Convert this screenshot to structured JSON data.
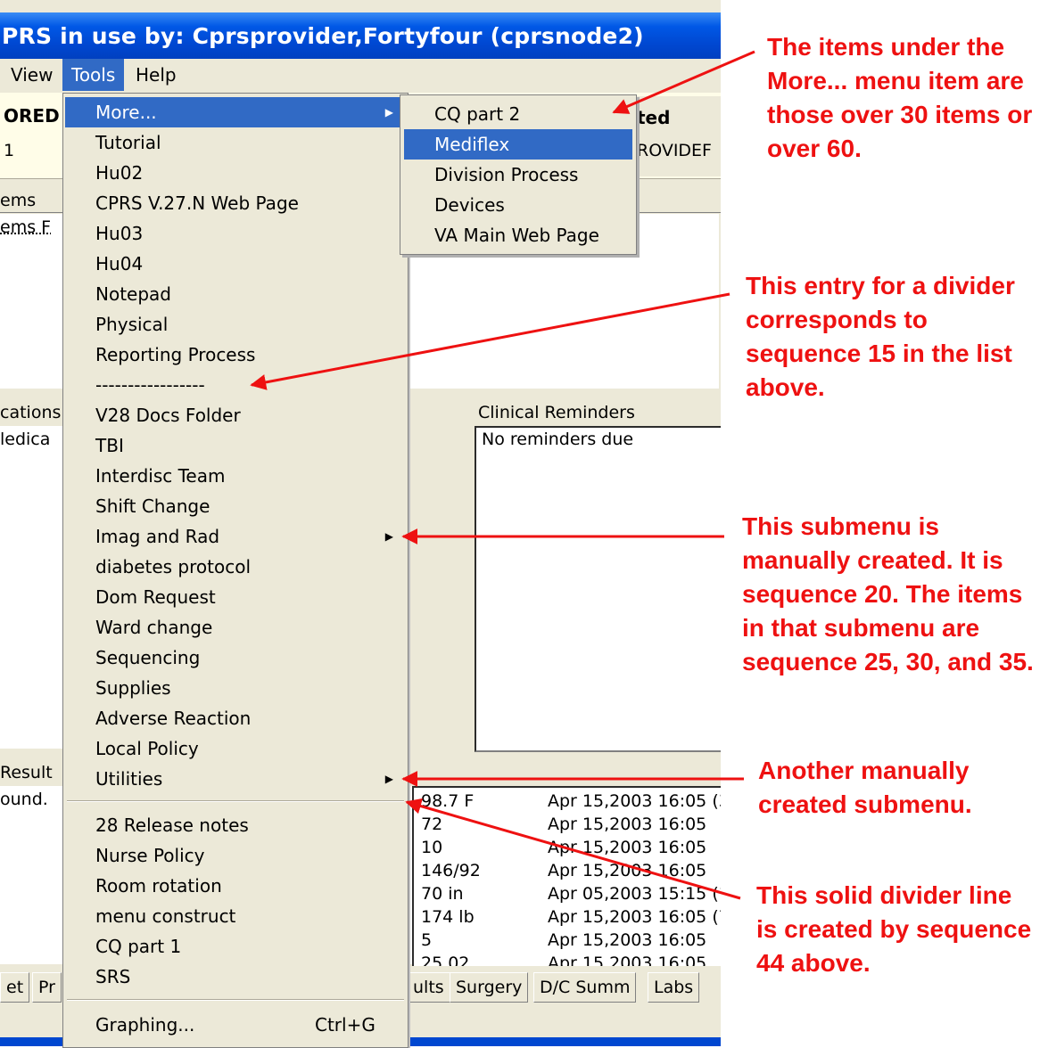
{
  "window": {
    "title": "PRS in use by: Cprsprovider,Fortyfour  (cprsnode2)",
    "title_color": "#0047d0"
  },
  "menubar": {
    "items": [
      "View",
      "Tools",
      "Help"
    ],
    "active": "Tools",
    "highlight_color": "#316ac5"
  },
  "background": {
    "patient_name": "ORED",
    "patient_sub": "1",
    "header_right_title": "ted",
    "header_right_value": "ROVIDEF",
    "items_label": "ems",
    "items_row": "ems F",
    "medications_header": "cations",
    "medications_row": "ledica",
    "reminders_header": "Clinical Reminders",
    "reminders_row": "No reminders due",
    "results_header": "Result",
    "results_row": "ound.",
    "vitals": [
      {
        "value": "98.7 F",
        "date": "Apr 15,2003 16:05 (3"
      },
      {
        "value": "72",
        "date": "Apr 15,2003 16:05"
      },
      {
        "value": "10",
        "date": "Apr 15,2003 16:05"
      },
      {
        "value": "146/92",
        "date": "Apr 15,2003 16:05"
      },
      {
        "value": "70 in",
        "date": "Apr 05,2003 15:15 (1"
      },
      {
        "value": "174 lb",
        "date": "Apr 15,2003 16:05 (7"
      },
      {
        "value": "5",
        "date": "Apr 15,2003 16:05"
      },
      {
        "value": "25.02",
        "date": "Apr 15,2003 16:05"
      }
    ],
    "tabs_left": [
      "et",
      "Pr"
    ],
    "tabs_right": [
      "ults",
      "Surgery",
      "D/C Summ",
      "Labs"
    ]
  },
  "tools_menu": {
    "items": [
      {
        "label": "More...",
        "submenu": true,
        "highlighted": true
      },
      {
        "label": "Tutorial"
      },
      {
        "label": "Hu02"
      },
      {
        "label": "CPRS V.27.N Web Page"
      },
      {
        "label": "Hu03"
      },
      {
        "label": "Hu04"
      },
      {
        "label": "Notepad"
      },
      {
        "label": "Physical"
      },
      {
        "label": "Reporting Process"
      },
      {
        "label": "-----------------"
      },
      {
        "label": "V28 Docs Folder"
      },
      {
        "label": "TBI"
      },
      {
        "label": "Interdisc Team"
      },
      {
        "label": "Shift Change"
      },
      {
        "label": "Imag and Rad",
        "submenu": true
      },
      {
        "label": "diabetes protocol"
      },
      {
        "label": "Dom Request"
      },
      {
        "label": "Ward change"
      },
      {
        "label": "Sequencing"
      },
      {
        "label": "Supplies"
      },
      {
        "label": "Adverse Reaction"
      },
      {
        "label": "Local Policy"
      },
      {
        "label": "Utilities",
        "submenu": true
      }
    ],
    "items_after_divider": [
      {
        "label": "28 Release notes"
      },
      {
        "label": "Nurse Policy"
      },
      {
        "label": "Room rotation"
      },
      {
        "label": "menu construct"
      },
      {
        "label": "CQ part 1"
      },
      {
        "label": "SRS"
      }
    ],
    "graphing": {
      "label": "Graphing...",
      "shortcut": "Ctrl+G"
    }
  },
  "more_menu": {
    "items": [
      {
        "label": "CQ part 2"
      },
      {
        "label": "Mediflex",
        "highlighted": true
      },
      {
        "label": "Division Process"
      },
      {
        "label": "Devices"
      },
      {
        "label": "VA Main Web Page"
      }
    ]
  },
  "annotations": {
    "color": "#ee1111",
    "note1": "The items under the\nMore... menu item are\nthose over 30 items or\nover 60.",
    "note2": "This entry for a divider\ncorresponds to\nsequence 15 in the list\nabove.",
    "note3": "This submenu is\nmanually created. It is\nsequence 20. The items\nin that submenu are\nsequence 25, 30, and 35.",
    "note4": "Another manually\ncreated submenu.",
    "note5": "This solid divider line\nis created by sequence\n44 above."
  }
}
